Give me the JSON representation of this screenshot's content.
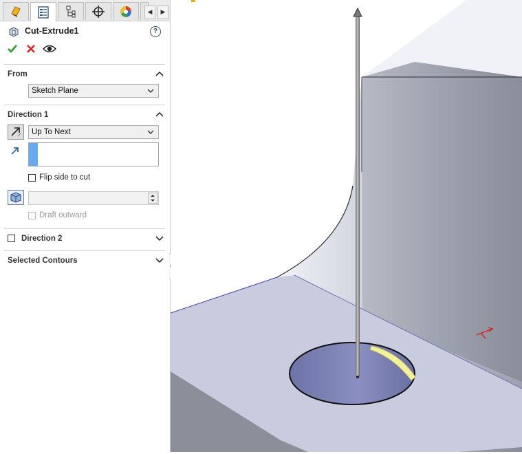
{
  "tabs": [
    {
      "name": "FeatureManager",
      "icon": "feature-tree-icon"
    },
    {
      "name": "PropertyManager",
      "icon": "property-manager-icon"
    },
    {
      "name": "ConfigurationManager",
      "icon": "configuration-icon"
    },
    {
      "name": "DimXpertManager",
      "icon": "crosshair-icon"
    },
    {
      "name": "DisplayManager",
      "icon": "display-manager-icon"
    }
  ],
  "feature": {
    "title": "Cut-Extrude1",
    "help_label": "?"
  },
  "from": {
    "header": "From",
    "option": "Sketch Plane"
  },
  "direction1": {
    "header": "Direction 1",
    "end_condition": "Up To Next",
    "flip_label": "Flip side to cut",
    "draft_value": "",
    "draft_outward_label": "Draft outward"
  },
  "direction2": {
    "header": "Direction 2"
  },
  "selected_contours": {
    "header": "Selected Contours"
  },
  "colors": {
    "accent": "#66aaf0",
    "ok": "#2a9d2a",
    "cancel": "#d02020",
    "trim_edge": "#f2f29a"
  }
}
